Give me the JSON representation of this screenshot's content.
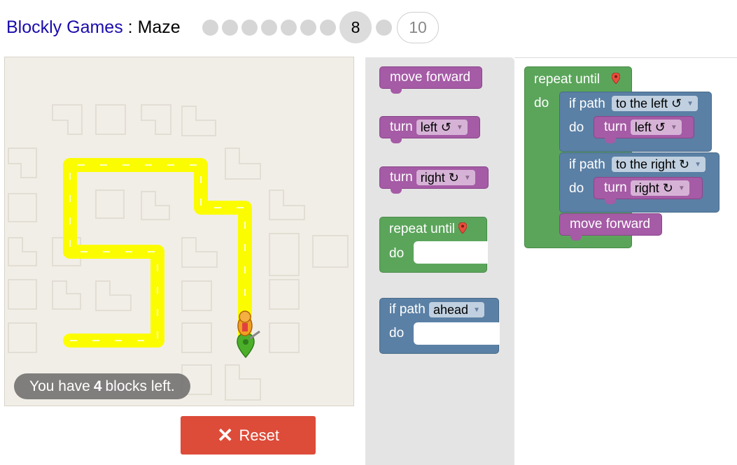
{
  "header": {
    "app_name": "Blockly Games",
    "separator": " : ",
    "game_name": "Maze",
    "current_level": "8",
    "next_level": "10"
  },
  "maze": {
    "capacity_prefix": "You have",
    "capacity_count": "4",
    "capacity_suffix": "blocks left."
  },
  "reset_button": {
    "label": "Reset"
  },
  "toolbox": {
    "move_forward": "move forward",
    "turn_left": {
      "label": "turn",
      "option": "left ↺"
    },
    "turn_right": {
      "label": "turn",
      "option": "right ↻"
    },
    "repeat_until": {
      "label": "repeat until",
      "do": "do"
    },
    "if_path": {
      "label": "if path",
      "option": "ahead",
      "do": "do"
    }
  },
  "workspace": {
    "repeat_label": "repeat until",
    "repeat_do": "do",
    "if1": {
      "label": "if path",
      "option": "to the left ↺",
      "do": "do"
    },
    "turn1": {
      "label": "turn",
      "option": "left ↺"
    },
    "if2": {
      "label": "if path",
      "option": "to the right ↻",
      "do": "do"
    },
    "turn2": {
      "label": "turn",
      "option": "right ↻"
    },
    "move_forward": "move forward"
  },
  "colors": {
    "motion_block": "#a55ba5",
    "loop_block": "#5ba55b",
    "logic_block": "#5b80a5",
    "path": "#ffff00",
    "reset_button": "#dd4b39"
  }
}
